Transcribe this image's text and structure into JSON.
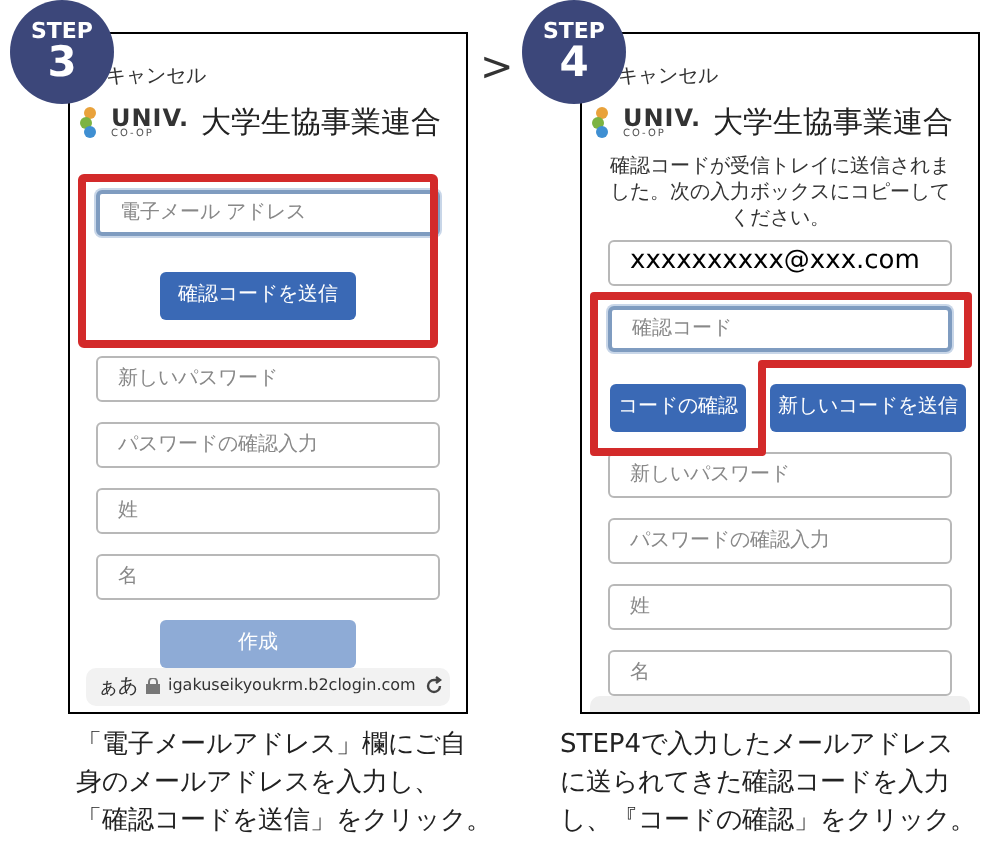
{
  "separator": ">",
  "steps": [
    {
      "badge_label": "STEP",
      "badge_number": "3",
      "highlight": {
        "kind": "box"
      },
      "phone": {
        "cancel": "キャンセル",
        "logo": {
          "mark": "UNIV.",
          "sub": "CO-OP",
          "name": "大学生協事業連合"
        },
        "highlighted": [
          {
            "kind": "field",
            "placeholder": "電子メール アドレス",
            "focused": true
          },
          {
            "kind": "button",
            "label": "確認コードを送信",
            "disabled": false
          }
        ],
        "items": [
          {
            "kind": "field",
            "placeholder": "新しいパスワード",
            "focused": false
          },
          {
            "kind": "field",
            "placeholder": "パスワードの確認入力",
            "focused": false
          },
          {
            "kind": "field",
            "placeholder": "姓",
            "focused": false
          },
          {
            "kind": "field",
            "placeholder": "名",
            "focused": false
          },
          {
            "kind": "button",
            "label": "作成",
            "disabled": true
          }
        ],
        "url_bar": {
          "text_size": "ぁあ",
          "url": "igakuseikyoukrm.b2clogin.com"
        }
      },
      "caption_lines": [
        "「電子メールアドレス」欄にご自",
        "身のメールアドレスを入力し、",
        "「確認コードを送信」をクリック。"
      ]
    },
    {
      "badge_label": "STEP",
      "badge_number": "4",
      "highlight": {
        "kind": "l-shape"
      },
      "phone": {
        "cancel": "キャンセル",
        "logo": {
          "mark": "UNIV.",
          "sub": "CO-OP",
          "name": "大学生協事業連合"
        },
        "message": "確認コードが受信トレイに送信されました。次の入力ボックスにコピーしてください。",
        "lead": [
          {
            "kind": "field",
            "value": "xxxxxxxxxx@xxx.com",
            "focused": false
          }
        ],
        "highlighted": [
          {
            "kind": "field",
            "placeholder": "確認コード",
            "focused": true
          },
          {
            "kind": "button_row",
            "buttons": [
              {
                "label": "コードの確認",
                "disabled": false
              },
              {
                "label": "新しいコードを送信",
                "disabled": false
              }
            ]
          }
        ],
        "items": [
          {
            "kind": "field",
            "placeholder": "新しいパスワード",
            "focused": false
          },
          {
            "kind": "field",
            "placeholder": "パスワードの確認入力",
            "focused": false
          },
          {
            "kind": "field",
            "placeholder": "姓",
            "focused": false
          },
          {
            "kind": "field",
            "placeholder": "名",
            "focused": false
          }
        ]
      },
      "caption_lines": [
        "STEP4で入力したメールアドレス",
        "に送られてきた確認コードを入力",
        "し、『コードの確認」をクリック。"
      ]
    }
  ]
}
